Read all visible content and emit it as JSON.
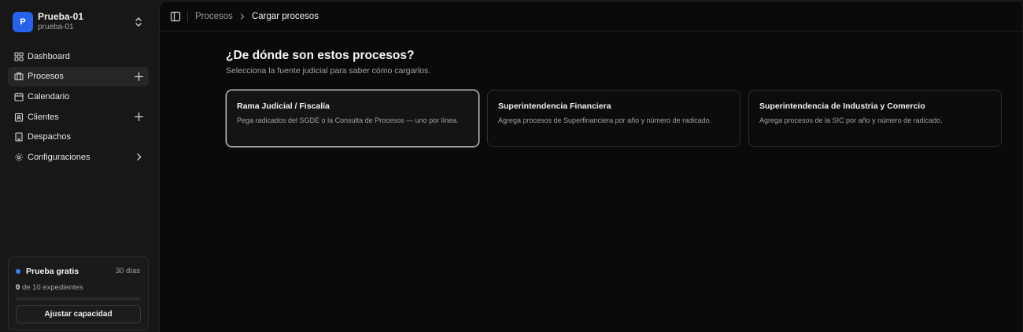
{
  "org": {
    "initial": "P",
    "name": "Prueba-01",
    "slug": "prueba-01",
    "avatar_color": "#2563eb"
  },
  "nav": {
    "items": [
      {
        "label": "Dashboard",
        "icon": "dashboard-grid-icon",
        "active": false,
        "trailing": ""
      },
      {
        "label": "Procesos",
        "icon": "briefcase-icon",
        "active": true,
        "trailing": "plus-icon"
      },
      {
        "label": "Calendario",
        "icon": "calendar-icon",
        "active": false,
        "trailing": ""
      },
      {
        "label": "Clientes",
        "icon": "contact-icon",
        "active": false,
        "trailing": "plus-icon"
      },
      {
        "label": "Despachos",
        "icon": "building-icon",
        "active": false,
        "trailing": ""
      },
      {
        "label": "Configuraciones",
        "icon": "gear-icon",
        "active": false,
        "trailing": "chevron-right-icon"
      }
    ]
  },
  "trial": {
    "title": "Prueba gratis",
    "days": "30 días",
    "used": "0",
    "usage_suffix": "de 10 expedientes",
    "progress": 0,
    "button_label": "Ajustar capacidad",
    "accent": "#3b82f6"
  },
  "breadcrumb": {
    "parent": "Procesos",
    "current": "Cargar procesos"
  },
  "page": {
    "title": "¿De dónde son estos procesos?",
    "subtitle": "Selecciona la fuente judicial para saber cómo cargarlos."
  },
  "sources": [
    {
      "title": "Rama Judicial / Fiscalía",
      "description": "Pega radicados del SGDE o la Consulta de Procesos — uno por línea.",
      "selected": true
    },
    {
      "title": "Superintendencia Financiera",
      "description": "Agrega procesos de Superfinanciera por año y número de radicado.",
      "selected": false
    },
    {
      "title": "Superintendencia de Industria y Comercio",
      "description": "Agrega procesos de la SIC por año y número de radicado.",
      "selected": false
    }
  ]
}
